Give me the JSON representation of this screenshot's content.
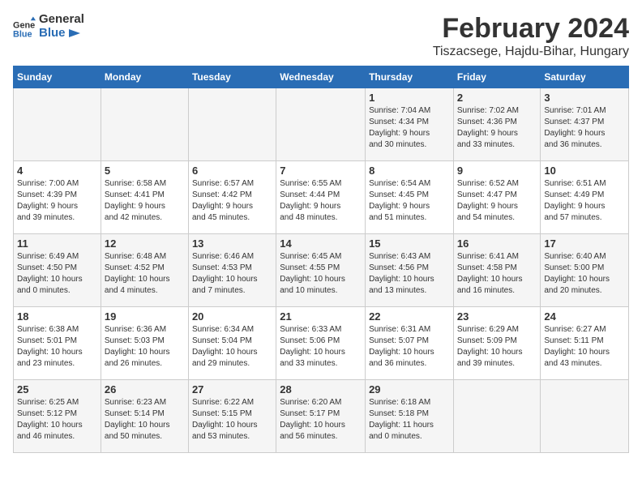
{
  "header": {
    "logo_text_general": "General",
    "logo_text_blue": "Blue",
    "month_year": "February 2024",
    "location": "Tiszacsege, Hajdu-Bihar, Hungary"
  },
  "days_of_week": [
    "Sunday",
    "Monday",
    "Tuesday",
    "Wednesday",
    "Thursday",
    "Friday",
    "Saturday"
  ],
  "weeks": [
    [
      {
        "day": "",
        "info": ""
      },
      {
        "day": "",
        "info": ""
      },
      {
        "day": "",
        "info": ""
      },
      {
        "day": "",
        "info": ""
      },
      {
        "day": "1",
        "info": "Sunrise: 7:04 AM\nSunset: 4:34 PM\nDaylight: 9 hours\nand 30 minutes."
      },
      {
        "day": "2",
        "info": "Sunrise: 7:02 AM\nSunset: 4:36 PM\nDaylight: 9 hours\nand 33 minutes."
      },
      {
        "day": "3",
        "info": "Sunrise: 7:01 AM\nSunset: 4:37 PM\nDaylight: 9 hours\nand 36 minutes."
      }
    ],
    [
      {
        "day": "4",
        "info": "Sunrise: 7:00 AM\nSunset: 4:39 PM\nDaylight: 9 hours\nand 39 minutes."
      },
      {
        "day": "5",
        "info": "Sunrise: 6:58 AM\nSunset: 4:41 PM\nDaylight: 9 hours\nand 42 minutes."
      },
      {
        "day": "6",
        "info": "Sunrise: 6:57 AM\nSunset: 4:42 PM\nDaylight: 9 hours\nand 45 minutes."
      },
      {
        "day": "7",
        "info": "Sunrise: 6:55 AM\nSunset: 4:44 PM\nDaylight: 9 hours\nand 48 minutes."
      },
      {
        "day": "8",
        "info": "Sunrise: 6:54 AM\nSunset: 4:45 PM\nDaylight: 9 hours\nand 51 minutes."
      },
      {
        "day": "9",
        "info": "Sunrise: 6:52 AM\nSunset: 4:47 PM\nDaylight: 9 hours\nand 54 minutes."
      },
      {
        "day": "10",
        "info": "Sunrise: 6:51 AM\nSunset: 4:49 PM\nDaylight: 9 hours\nand 57 minutes."
      }
    ],
    [
      {
        "day": "11",
        "info": "Sunrise: 6:49 AM\nSunset: 4:50 PM\nDaylight: 10 hours\nand 0 minutes."
      },
      {
        "day": "12",
        "info": "Sunrise: 6:48 AM\nSunset: 4:52 PM\nDaylight: 10 hours\nand 4 minutes."
      },
      {
        "day": "13",
        "info": "Sunrise: 6:46 AM\nSunset: 4:53 PM\nDaylight: 10 hours\nand 7 minutes."
      },
      {
        "day": "14",
        "info": "Sunrise: 6:45 AM\nSunset: 4:55 PM\nDaylight: 10 hours\nand 10 minutes."
      },
      {
        "day": "15",
        "info": "Sunrise: 6:43 AM\nSunset: 4:56 PM\nDaylight: 10 hours\nand 13 minutes."
      },
      {
        "day": "16",
        "info": "Sunrise: 6:41 AM\nSunset: 4:58 PM\nDaylight: 10 hours\nand 16 minutes."
      },
      {
        "day": "17",
        "info": "Sunrise: 6:40 AM\nSunset: 5:00 PM\nDaylight: 10 hours\nand 20 minutes."
      }
    ],
    [
      {
        "day": "18",
        "info": "Sunrise: 6:38 AM\nSunset: 5:01 PM\nDaylight: 10 hours\nand 23 minutes."
      },
      {
        "day": "19",
        "info": "Sunrise: 6:36 AM\nSunset: 5:03 PM\nDaylight: 10 hours\nand 26 minutes."
      },
      {
        "day": "20",
        "info": "Sunrise: 6:34 AM\nSunset: 5:04 PM\nDaylight: 10 hours\nand 29 minutes."
      },
      {
        "day": "21",
        "info": "Sunrise: 6:33 AM\nSunset: 5:06 PM\nDaylight: 10 hours\nand 33 minutes."
      },
      {
        "day": "22",
        "info": "Sunrise: 6:31 AM\nSunset: 5:07 PM\nDaylight: 10 hours\nand 36 minutes."
      },
      {
        "day": "23",
        "info": "Sunrise: 6:29 AM\nSunset: 5:09 PM\nDaylight: 10 hours\nand 39 minutes."
      },
      {
        "day": "24",
        "info": "Sunrise: 6:27 AM\nSunset: 5:11 PM\nDaylight: 10 hours\nand 43 minutes."
      }
    ],
    [
      {
        "day": "25",
        "info": "Sunrise: 6:25 AM\nSunset: 5:12 PM\nDaylight: 10 hours\nand 46 minutes."
      },
      {
        "day": "26",
        "info": "Sunrise: 6:23 AM\nSunset: 5:14 PM\nDaylight: 10 hours\nand 50 minutes."
      },
      {
        "day": "27",
        "info": "Sunrise: 6:22 AM\nSunset: 5:15 PM\nDaylight: 10 hours\nand 53 minutes."
      },
      {
        "day": "28",
        "info": "Sunrise: 6:20 AM\nSunset: 5:17 PM\nDaylight: 10 hours\nand 56 minutes."
      },
      {
        "day": "29",
        "info": "Sunrise: 6:18 AM\nSunset: 5:18 PM\nDaylight: 11 hours\nand 0 minutes."
      },
      {
        "day": "",
        "info": ""
      },
      {
        "day": "",
        "info": ""
      }
    ]
  ]
}
